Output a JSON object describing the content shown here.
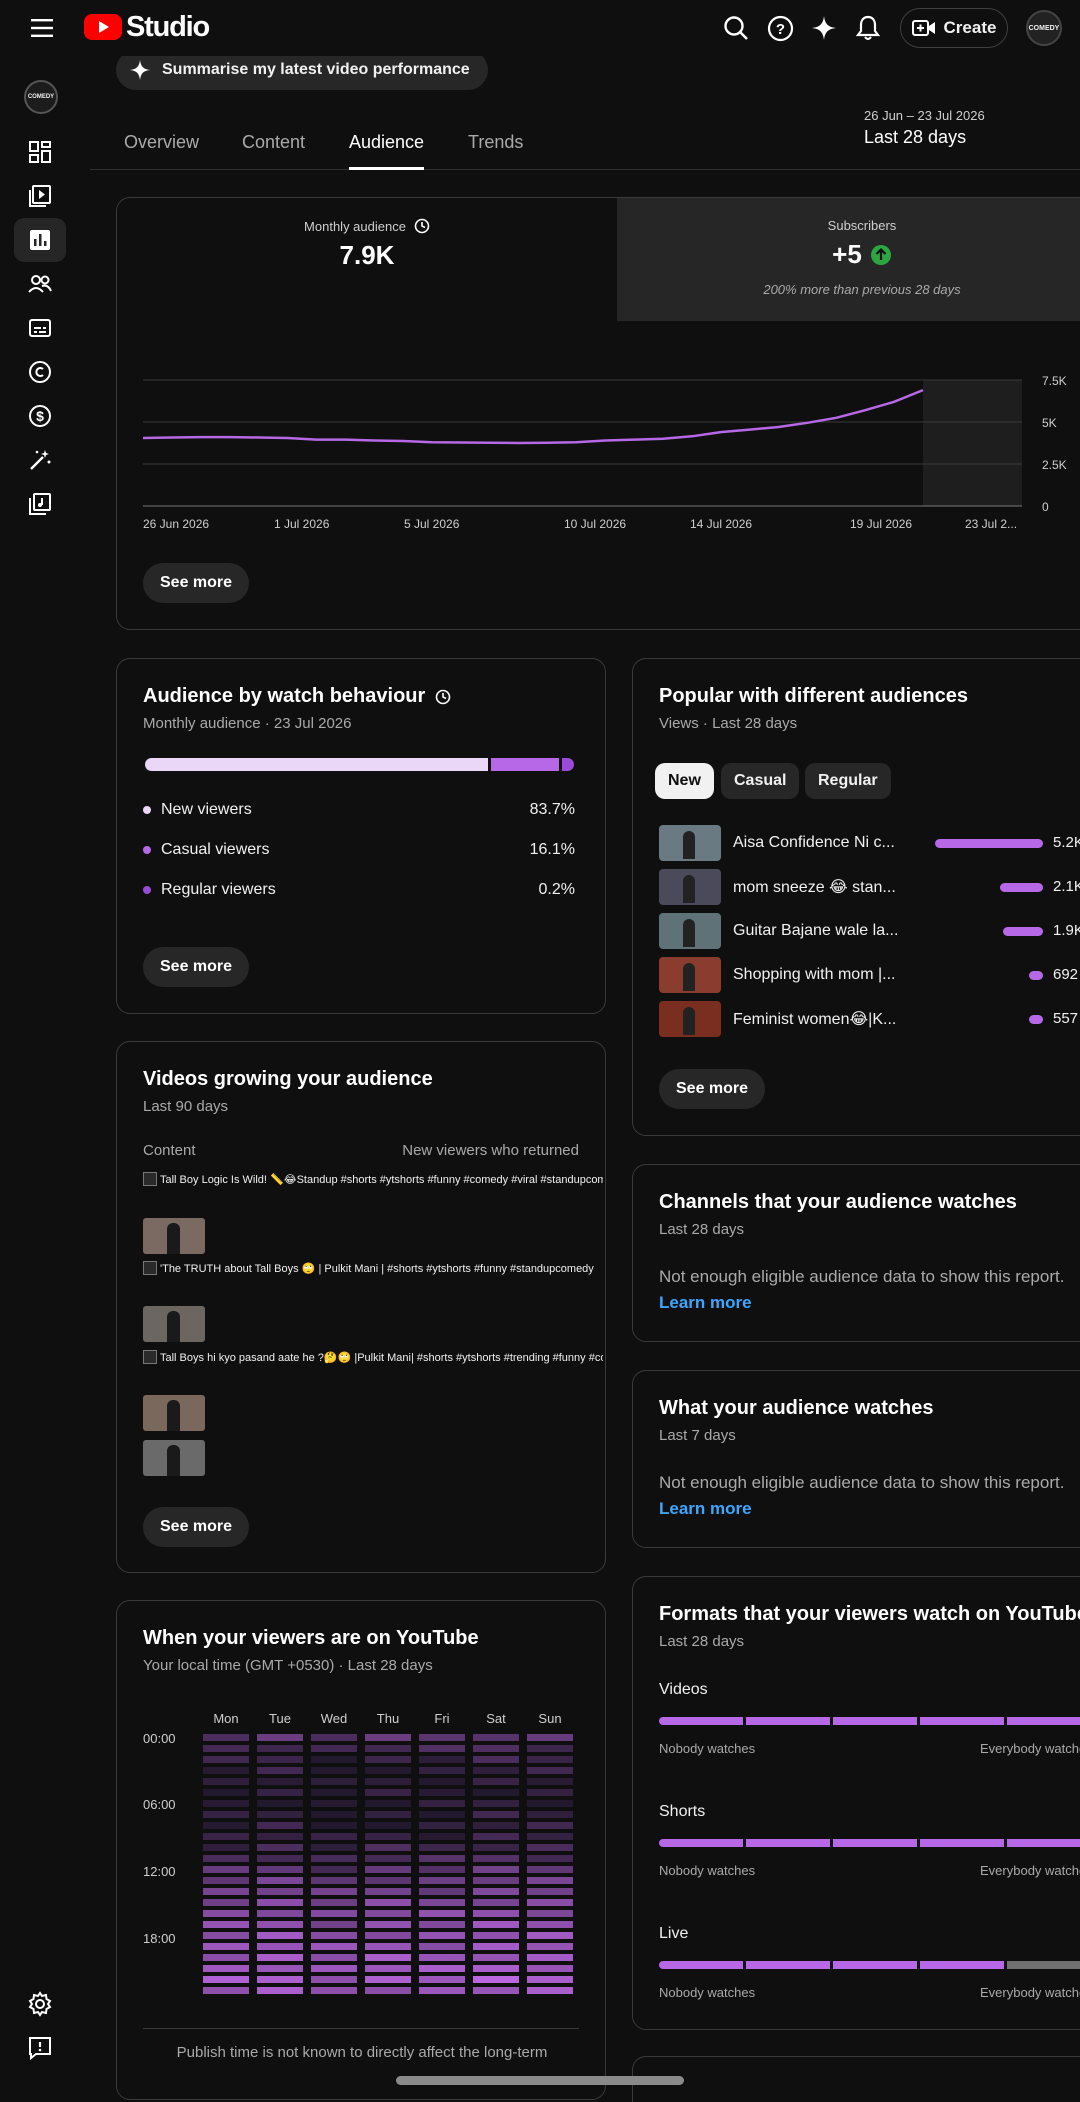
{
  "topbar": {
    "app_name": "Studio",
    "create_label": "Create",
    "avatar_text": "COMEDY"
  },
  "summary_chip": {
    "label": "Summarise my latest video performance"
  },
  "tabs": [
    {
      "label": "Overview",
      "active": false
    },
    {
      "label": "Content",
      "active": false
    },
    {
      "label": "Audience",
      "active": true
    },
    {
      "label": "Trends",
      "active": false
    }
  ],
  "date_range": {
    "range": "26 Jun – 23 Jul 2026",
    "label": "Last 28 days"
  },
  "overview": {
    "monthly_label": "Monthly audience",
    "monthly_value": "7.9K",
    "subs_label": "Subscribers",
    "subs_value": "+5",
    "subs_note": "200% more than previous 28 days",
    "see_more": "See more"
  },
  "chart_data": {
    "type": "line",
    "x": [
      "26 Jun 2026",
      "1 Jul 2026",
      "5 Jul 2026",
      "10 Jul 2026",
      "14 Jul 2026",
      "19 Jul 2026",
      "23 Jul 2026"
    ],
    "x_labels_shown": [
      "26 Jun 2026",
      "1 Jul 2026",
      "5 Jul 2026",
      "10 Jul 2026",
      "14 Jul 2026",
      "19 Jul 2026",
      "23 Jul 2..."
    ],
    "series": [
      {
        "values": [
          4050,
          4080,
          4100,
          4100,
          4080,
          4050,
          3950,
          3950,
          3900,
          3870,
          3800,
          3780,
          3760,
          3750,
          3770,
          3800,
          3900,
          3950,
          4000,
          4150,
          4400,
          4550,
          4700,
          4950,
          5250,
          5700,
          6200,
          6900
        ]
      }
    ],
    "yticks": [
      "0",
      "2.5K",
      "5K",
      "7.5K"
    ],
    "ylim": [
      0,
      7500
    ],
    "line_color": "#b768e6",
    "grid": true
  },
  "watch_behaviour": {
    "title": "Audience by watch behaviour",
    "subtitle": "Monthly audience · 23 Jul 2026",
    "segments": [
      {
        "name": "New viewers",
        "value": "83.7%",
        "fraction": 0.837,
        "color": "#ead7f7"
      },
      {
        "name": "Casual viewers",
        "value": "16.1%",
        "fraction": 0.161,
        "color": "#b768e6"
      },
      {
        "name": "Regular viewers",
        "value": "0.2%",
        "fraction": 0.002,
        "color": "#9a4ad6"
      }
    ],
    "see_more": "See more"
  },
  "popular": {
    "title": "Popular with different audiences",
    "subtitle": "Views · Last 28 days",
    "pills": [
      "New",
      "Casual",
      "Regular"
    ],
    "rows": [
      {
        "title": "Aisa Confidence Ni c...",
        "value": "5.2K",
        "fraction": 1.0
      },
      {
        "title": "mom sneeze 😂 stan...",
        "value": "2.1K",
        "fraction": 0.4
      },
      {
        "title": "Guitar Bajane wale la...",
        "value": "1.9K",
        "fraction": 0.37
      },
      {
        "title": "Shopping with mom |...",
        "value": "692",
        "fraction": 0.13
      },
      {
        "title": "Feminist women😂|K...",
        "value": "557",
        "fraction": 0.11
      }
    ],
    "see_more": "See more"
  },
  "growing": {
    "title": "Videos growing your audience",
    "subtitle": "Last 90 days",
    "col_content": "Content",
    "col_metric": "New viewers who returned",
    "rows": [
      {
        "title": "Tall Boy Logic Is Wild! 📏😂Standup #shorts #ytshorts #funny #comedy #viral #standupcomedy"
      },
      {
        "title": "'The TRUTH about Tall Boys 🙄 | Pulkit Mani | #shorts #ytshorts #funny #standupcomedy"
      },
      {
        "title": "Tall Boys hi kyo pasand aate he ?🤔🙄 |Pulkit Mani| #shorts #ytshorts #trending #funny #comedy"
      }
    ],
    "see_more": "See more"
  },
  "channels": {
    "title": "Channels that your audience watches",
    "subtitle": "Last 28 days",
    "message": "Not enough eligible audience data to show this report.",
    "link": "Learn more"
  },
  "watches": {
    "title": "What your audience watches",
    "subtitle": "Last 7 days",
    "message": "Not enough eligible audience data to show this report.",
    "link": "Learn more"
  },
  "when": {
    "title": "When your viewers are on YouTube",
    "subtitle": "Your local time (GMT +0530) · Last 28 days",
    "days": [
      "Mon",
      "Tue",
      "Wed",
      "Thu",
      "Fri",
      "Sat",
      "Sun"
    ],
    "hours": [
      "00:00",
      "06:00",
      "12:00",
      "18:00"
    ],
    "footer": "Publish time is not known to directly affect the long-term"
  },
  "formats": {
    "title": "Formats that your viewers watch on YouTube",
    "subtitle": "Last 28 days",
    "scale_low": "Nobody watches",
    "scale_high": "Everybody watches",
    "rows": [
      {
        "label": "Videos",
        "filled_segments": 5
      },
      {
        "label": "Shorts",
        "filled_segments": 5
      },
      {
        "label": "Live",
        "filled_segments": 4
      }
    ]
  },
  "colors": {
    "accent": "#b768e6",
    "brand": "#ff0000",
    "link": "#3ea6ff",
    "up_green": "#2ba640"
  }
}
